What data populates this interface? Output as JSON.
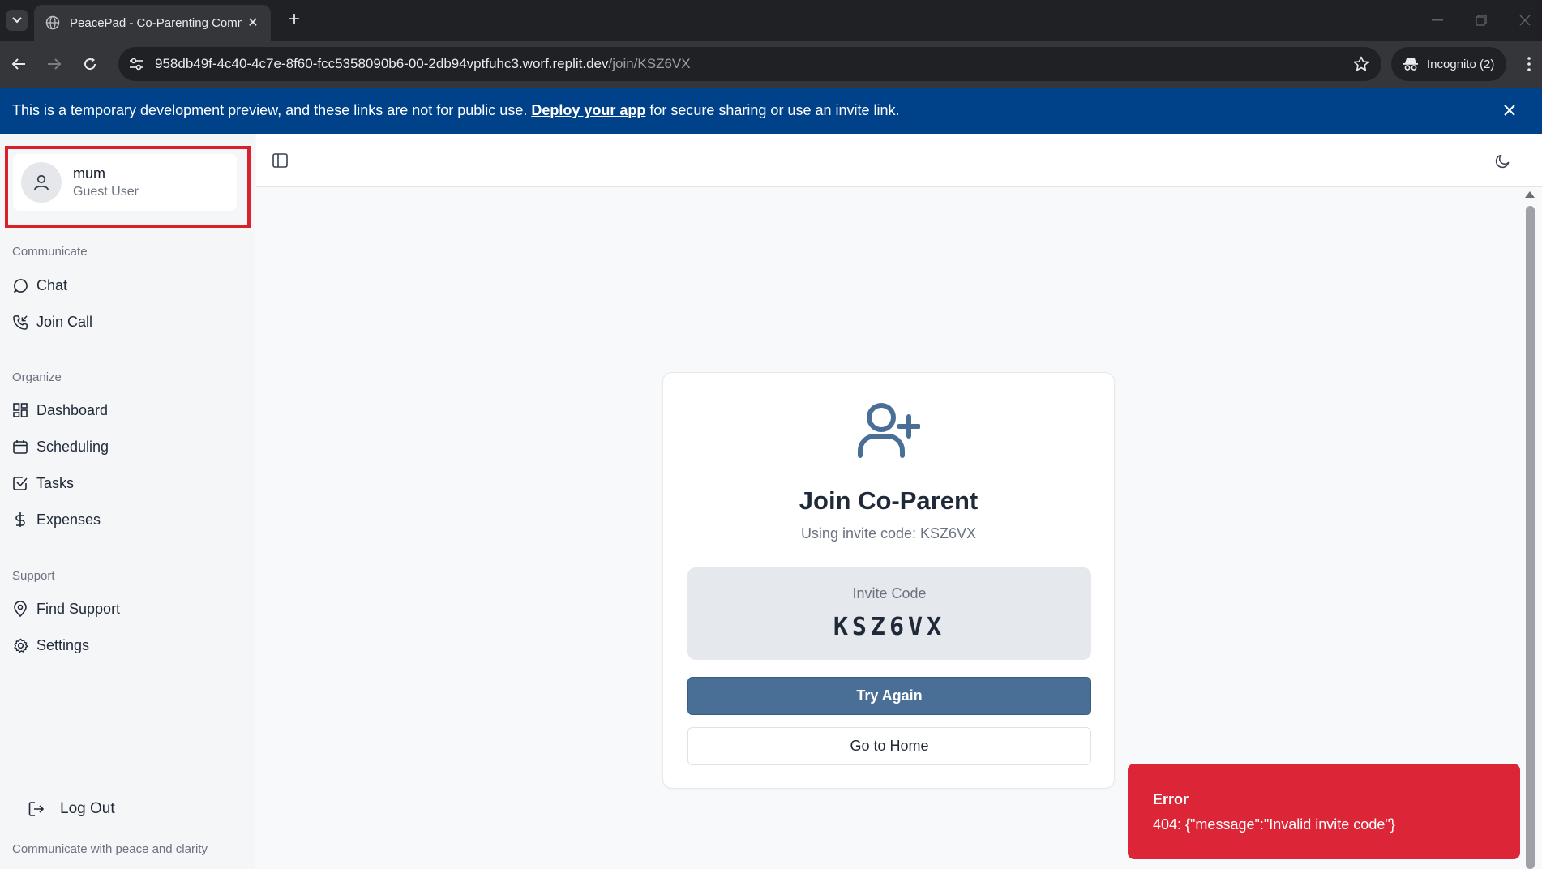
{
  "browser": {
    "tab_title": "PeacePad - Co-Parenting Comm",
    "url_host": "958db49f-4c40-4c7e-8f60-fcc5358090b6-00-2db94vptfuhc3.worf.replit.dev",
    "url_path": "/join/KSZ6VX",
    "incognito_label": "Incognito (2)"
  },
  "banner": {
    "text_before": "This is a temporary development preview, and these links are not for public use.",
    "link_text": "Deploy your app",
    "text_after": "for secure sharing or use an invite link."
  },
  "sidebar": {
    "user": {
      "name": "mum",
      "role": "Guest User"
    },
    "sections": [
      {
        "label": "Communicate",
        "items": [
          {
            "label": "Chat",
            "icon": "message-circle-icon"
          },
          {
            "label": "Join Call",
            "icon": "phone-incoming-icon"
          }
        ]
      },
      {
        "label": "Organize",
        "items": [
          {
            "label": "Dashboard",
            "icon": "dashboard-icon"
          },
          {
            "label": "Scheduling",
            "icon": "calendar-icon"
          },
          {
            "label": "Tasks",
            "icon": "check-square-icon"
          },
          {
            "label": "Expenses",
            "icon": "dollar-icon"
          }
        ]
      },
      {
        "label": "Support",
        "items": [
          {
            "label": "Find Support",
            "icon": "map-pin-icon"
          },
          {
            "label": "Settings",
            "icon": "gear-icon"
          }
        ]
      }
    ],
    "logout_label": "Log Out",
    "tagline": "Communicate with peace and clarity"
  },
  "join": {
    "title": "Join Co-Parent",
    "subtitle": "Using invite code: KSZ6VX",
    "code_label": "Invite Code",
    "code_value": "KSZ6VX",
    "primary_button": "Try Again",
    "secondary_button": "Go to Home"
  },
  "toast": {
    "title": "Error",
    "message": "404: {\"message\":\"Invalid invite code\"}"
  },
  "colors": {
    "banner": "#00428a",
    "primary": "#4a6f97",
    "error": "#dc2638",
    "highlight": "#d9202b"
  }
}
